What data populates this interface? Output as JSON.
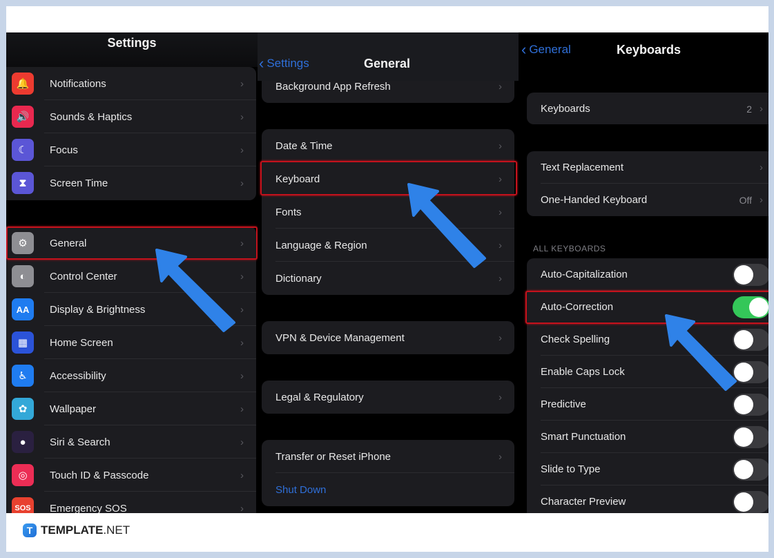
{
  "panel_settings": {
    "title": "Settings",
    "group1": [
      {
        "label": "Notifications",
        "icon": "bell-icon",
        "glyph": "🔔",
        "color": "#ec3b30"
      },
      {
        "label": "Sounds & Haptics",
        "icon": "speaker-icon",
        "glyph": "🔊",
        "color": "#e9284f"
      },
      {
        "label": "Focus",
        "icon": "moon-icon",
        "glyph": "☾",
        "color": "#5b56d6"
      },
      {
        "label": "Screen Time",
        "icon": "hourglass-icon",
        "glyph": "⧗",
        "color": "#5b56d6"
      }
    ],
    "group2": [
      {
        "label": "General",
        "icon": "gear-icon",
        "glyph": "⚙",
        "color": "#8e8e93"
      },
      {
        "label": "Control Center",
        "icon": "switches-icon",
        "glyph": "◐",
        "color": "#8e8e93"
      },
      {
        "label": "Display & Brightness",
        "icon": "text-size-icon",
        "glyph": "AA",
        "color": "#1f7cf0"
      },
      {
        "label": "Home Screen",
        "icon": "app-grid-icon",
        "glyph": "▦",
        "color": "#2b53d8"
      },
      {
        "label": "Accessibility",
        "icon": "accessibility-icon",
        "glyph": "♿",
        "color": "#1f7cf0"
      },
      {
        "label": "Wallpaper",
        "icon": "flower-icon",
        "glyph": "✿",
        "color": "#33a8d8"
      },
      {
        "label": "Siri & Search",
        "icon": "siri-icon",
        "glyph": "●",
        "color": "#2a2040"
      },
      {
        "label": "Touch ID & Passcode",
        "icon": "fingerprint-icon",
        "glyph": "◎",
        "color": "#ec2d55"
      },
      {
        "label": "Emergency SOS",
        "icon": "sos-icon",
        "glyph": "SOS",
        "color": "#e8412f"
      }
    ]
  },
  "panel_general": {
    "back_label": "Settings",
    "title": "General",
    "group1": [
      {
        "label": "Background App Refresh"
      }
    ],
    "group2": [
      {
        "label": "Date & Time"
      },
      {
        "label": "Keyboard"
      },
      {
        "label": "Fonts"
      },
      {
        "label": "Language & Region"
      },
      {
        "label": "Dictionary"
      }
    ],
    "group3": [
      {
        "label": "VPN & Device Management"
      }
    ],
    "group4": [
      {
        "label": "Legal & Regulatory"
      }
    ],
    "group5": [
      {
        "label": "Transfer or Reset iPhone"
      },
      {
        "label": "Shut Down"
      }
    ]
  },
  "panel_keyboards": {
    "back_label": "General",
    "title": "Keyboards",
    "keyboards_row": {
      "label": "Keyboards",
      "value": "2"
    },
    "group2": [
      {
        "label": "Text Replacement",
        "value": ""
      },
      {
        "label": "One-Handed Keyboard",
        "value": "Off"
      }
    ],
    "section_header": "ALL KEYBOARDS",
    "toggles": [
      {
        "label": "Auto-Capitalization",
        "on": false
      },
      {
        "label": "Auto-Correction",
        "on": true
      },
      {
        "label": "Check Spelling",
        "on": false
      },
      {
        "label": "Enable Caps Lock",
        "on": false
      },
      {
        "label": "Predictive",
        "on": false
      },
      {
        "label": "Smart Punctuation",
        "on": false
      },
      {
        "label": "Slide to Type",
        "on": false
      },
      {
        "label": "Character Preview",
        "on": false
      }
    ]
  },
  "chevron": "›",
  "back_chevron": "‹",
  "brand": {
    "bold": "TEMPLATE",
    "light": ".NET",
    "logo_letter": "T"
  },
  "colors": {
    "accent_blue": "#2f6fd8",
    "highlight_red": "#c4121c",
    "arrow_blue": "#2f82e8",
    "toggle_green": "#34c759"
  }
}
